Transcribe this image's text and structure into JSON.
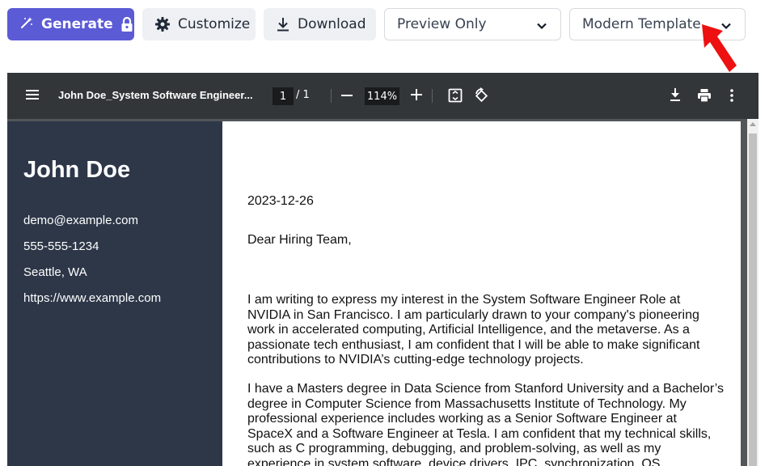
{
  "toolbar": {
    "generate_label": "Generate",
    "customize_label": "Customize",
    "download_label": "Download",
    "preview_select": {
      "value": "Preview Only"
    },
    "template_select": {
      "value": "Modern Template"
    },
    "accent_color": "#5b5bd6"
  },
  "viewer": {
    "file_title": "John Doe_System Software Engineer...",
    "current_page": "1",
    "page_separator": "/ 1",
    "zoom": "114%"
  },
  "resume": {
    "name": "John Doe",
    "email": "demo@example.com",
    "phone": "555-555-1234",
    "location": "Seattle, WA",
    "website": "https://www.example.com",
    "sidebar_color": "#2d3748"
  },
  "letter": {
    "date": "2023-12-26",
    "greeting": "Dear Hiring Team,",
    "paragraph1": "I am writing to express my interest in the System Software Engineer Role at NVIDIA in San Francisco. I am particularly drawn to your company's pioneering work in accelerated computing, Artificial Intelligence, and the metaverse. As a passionate tech enthusiast, I am confident that I will be able to make significant contributions to NVIDIA’s cutting-edge technology projects.",
    "paragraph2": "I have a Masters degree in Data Science from Stanford University and a Bachelor’s degree in Computer Science from Massachusetts Institute of Technology. My professional experience includes working as a Senior Software Engineer at SpaceX and a Software Engineer at Tesla. I am confident that my technical skills, such as C programming, debugging, and problem-solving, as well as my experience in system software, device drivers, IPC, synchronization, OS"
  },
  "icons": {
    "generate": "magic-wand-icon",
    "lock": "lock-icon",
    "customize": "gear-icon",
    "download": "download-icon",
    "dropdown": "chevron-down-icon",
    "annotation": "red-arrow-icon"
  }
}
